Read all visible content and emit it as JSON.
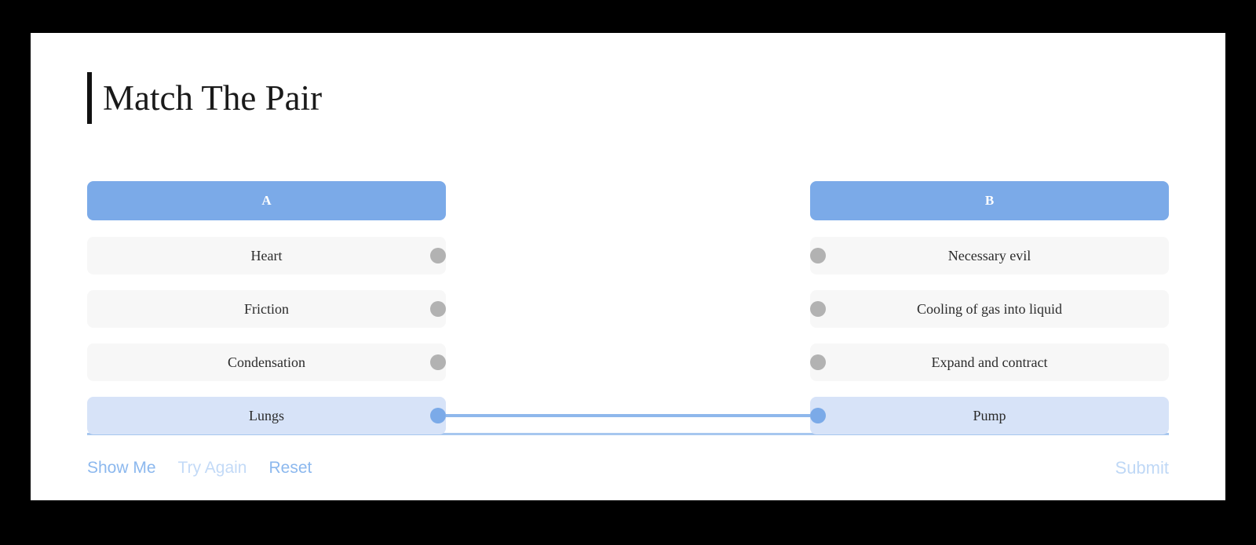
{
  "page": {
    "title": "Match The Pair"
  },
  "board": {
    "header_a": "A",
    "header_b": "B",
    "left_items": [
      {
        "label": "Heart"
      },
      {
        "label": "Friction"
      },
      {
        "label": "Condensation"
      },
      {
        "label": "Lungs"
      }
    ],
    "right_items": [
      {
        "label": "Necessary evil"
      },
      {
        "label": "Cooling of gas into liquid"
      },
      {
        "label": "Expand and contract"
      },
      {
        "label": "Pump"
      }
    ],
    "matched_pair": {
      "left": "Lungs",
      "right": "Pump"
    }
  },
  "footer": {
    "show_me": "Show Me",
    "try_again": "Try Again",
    "reset": "Reset",
    "submit": "Submit"
  },
  "colors": {
    "header_blue": "#7BAAE8",
    "row_gray": "#f7f7f7",
    "matched_blue": "#d7e3f8",
    "connector_blue": "#8FB8EC",
    "dot_gray": "#b2b2b2",
    "link_blue": "#a7caf2",
    "divider_blue": "#a7c7ef",
    "card_white": "#ffffff",
    "page_black": "#000000"
  }
}
